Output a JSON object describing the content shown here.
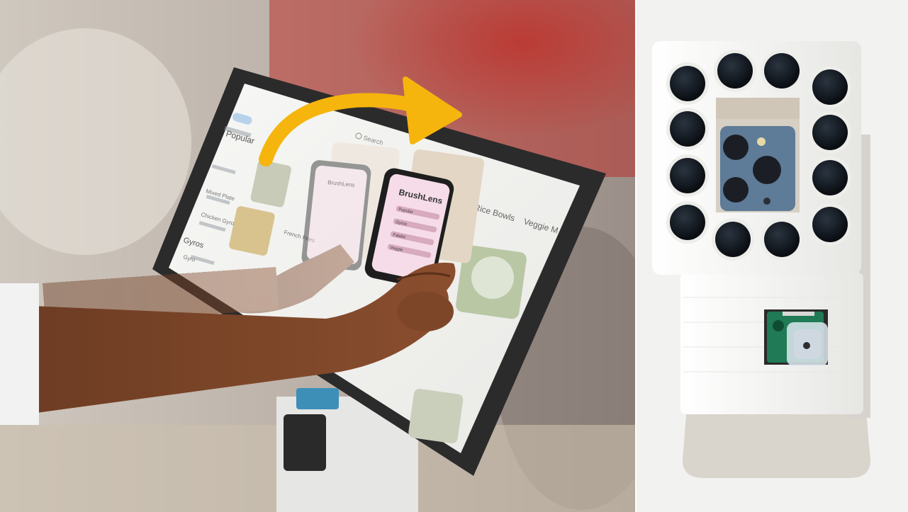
{
  "kiosk": {
    "categories": [
      "Popular",
      "Gyros",
      "Rice Bowls",
      "Veggie M"
    ],
    "search_label": "Search",
    "menu_items": [
      "Mixed Plate",
      "Chicken Gyro",
      "French Fries",
      "Gyro"
    ]
  },
  "phone_app": {
    "title": "BrushLens",
    "list_items": [
      "Popular",
      "Gyros",
      "Falafel",
      "Veggie"
    ]
  },
  "colors": {
    "arrow": "#f5b50d",
    "kiosk_frame": "#2b2b2b",
    "phone_screen": "#f6dce8",
    "case_white": "#f4f4f1"
  },
  "icons": {
    "arrow": "curved-arrow-icon",
    "search": "search-icon"
  }
}
